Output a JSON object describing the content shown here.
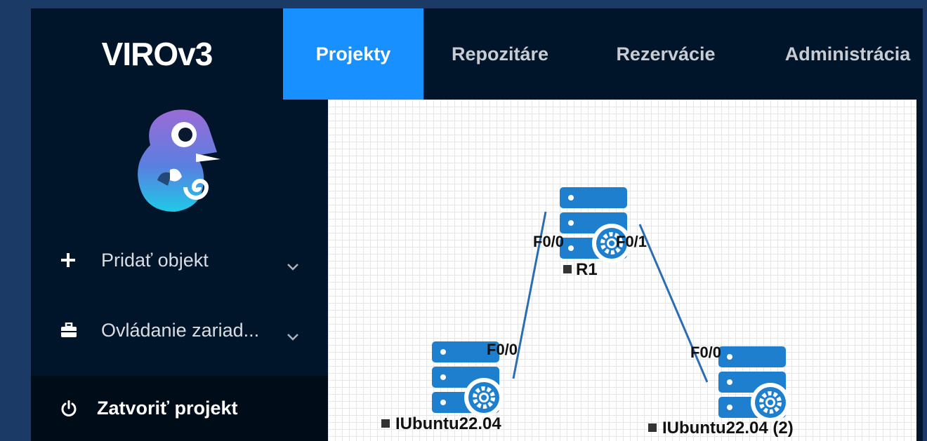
{
  "brand": {
    "title": "VIROv3"
  },
  "nav": {
    "tabs": [
      {
        "label": "Projekty",
        "active": true
      },
      {
        "label": "Repozitáre",
        "active": false
      },
      {
        "label": "Rezervácie",
        "active": false
      },
      {
        "label": "Administrácia",
        "active": false
      }
    ]
  },
  "sidebar": {
    "items": [
      {
        "label": "Pridať objekt",
        "icon": "plus-icon",
        "has_submenu": true
      },
      {
        "label": "Ovládanie zariad...",
        "icon": "toolbox-icon",
        "has_submenu": true
      },
      {
        "label": "Zatvoriť projekt",
        "icon": "power-icon",
        "has_submenu": false
      }
    ]
  },
  "topology": {
    "devices": [
      {
        "name": "R1",
        "icon": "server-gear-icon"
      },
      {
        "name": "IUbuntu22.04",
        "icon": "server-gear-icon"
      },
      {
        "name": "IUbuntu22.04 (2)",
        "icon": "server-gear-icon"
      }
    ],
    "links": [
      {
        "from": "R1",
        "from_port": "F0/0",
        "to": "IUbuntu22.04",
        "to_port": "F0/0"
      },
      {
        "from": "R1",
        "from_port": "F0/1",
        "to": "IUbuntu22.04 (2)",
        "to_port": "F0/0"
      }
    ]
  },
  "colors": {
    "background": "#1b3a66",
    "panel": "#001529",
    "accent": "#1890ff",
    "device_blue": "#1f7fcf",
    "link_line": "#2a6db3"
  }
}
